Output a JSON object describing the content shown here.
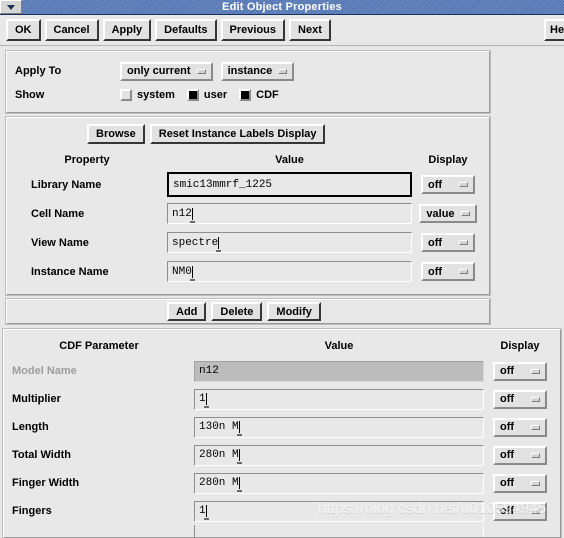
{
  "window": {
    "title": "Edit Object Properties",
    "menu_icon": "chevron-down-icon"
  },
  "toolbar": {
    "buttons": [
      {
        "label": "OK"
      },
      {
        "label": "Cancel"
      },
      {
        "label": "Apply"
      },
      {
        "label": "Defaults"
      },
      {
        "label": "Previous"
      },
      {
        "label": "Next"
      }
    ],
    "help_label": "Help"
  },
  "apply_to": {
    "label": "Apply To",
    "scope_value": "only current",
    "target_value": "instance",
    "show_label": "Show",
    "show_options": [
      {
        "label": "system",
        "checked": false
      },
      {
        "label": "user",
        "checked": true
      },
      {
        "label": "CDF",
        "checked": true
      }
    ]
  },
  "property_section": {
    "browse_label": "Browse",
    "reset_label": "Reset Instance Labels Display",
    "headers": {
      "property": "Property",
      "value": "Value",
      "display": "Display"
    },
    "rows": [
      {
        "name": "Library Name",
        "value": "smic13mmrf_1225",
        "display": "off",
        "focused": true,
        "caret": false
      },
      {
        "name": "Cell Name",
        "value": "n12",
        "display": "value",
        "focused": false,
        "caret": true
      },
      {
        "name": "View Name",
        "value": "spectre",
        "display": "off",
        "focused": false,
        "caret": true
      },
      {
        "name": "Instance Name",
        "value": "NM0",
        "display": "off",
        "focused": false,
        "caret": true
      }
    ]
  },
  "action_bar": {
    "buttons": [
      {
        "label": "Add"
      },
      {
        "label": "Delete"
      },
      {
        "label": "Modify"
      }
    ]
  },
  "cdf_section": {
    "headers": {
      "parameter": "CDF Parameter",
      "value": "Value",
      "display": "Display"
    },
    "rows": [
      {
        "name": "Model Name",
        "value": "n12",
        "display": "off",
        "disabled": true,
        "caret": false
      },
      {
        "name": "Multiplier",
        "value": "1",
        "display": "off",
        "disabled": false,
        "caret": true
      },
      {
        "name": "Length",
        "value": "130n M",
        "display": "off",
        "disabled": false,
        "caret": true
      },
      {
        "name": "Total Width",
        "value": "280n M",
        "display": "off",
        "disabled": false,
        "caret": true
      },
      {
        "name": "Finger Width",
        "value": "280n M",
        "display": "off",
        "disabled": false,
        "caret": true
      },
      {
        "name": "Fingers",
        "value": "1",
        "display": "off",
        "disabled": false,
        "caret": true
      }
    ]
  },
  "watermark": {
    "text": "https://blog.csdn.net/u010594945"
  },
  "colors": {
    "titlebar": "#4d6fae",
    "face": "#e8e8e8",
    "field": "#e8e8e8",
    "disabled_field": "#bcbcbc"
  }
}
